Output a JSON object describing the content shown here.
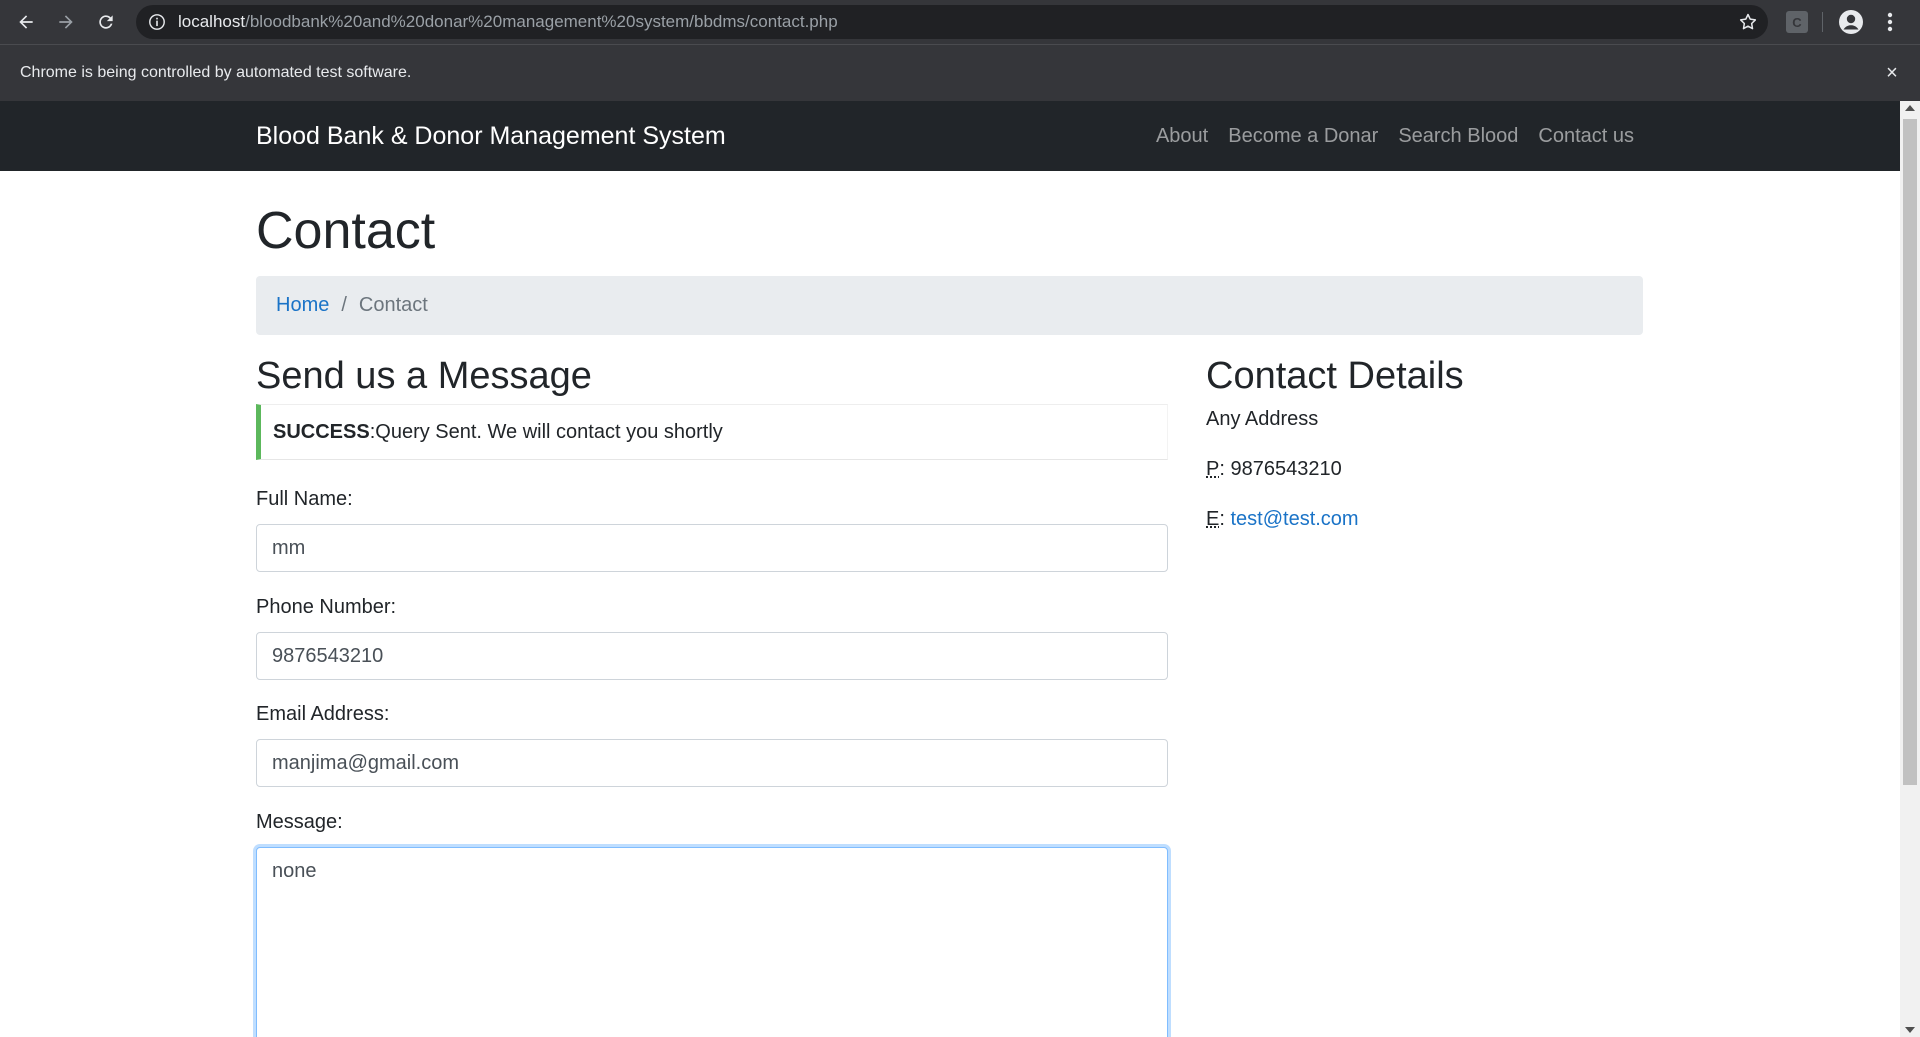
{
  "browser": {
    "url_host": "localhost",
    "url_path": "/bloodbank%20and%20donar%20management%20system/bbdms/contact.php",
    "ext_letter": "C",
    "infobar_message": "Chrome is being controlled by automated test software.",
    "infobar_close": "×"
  },
  "navbar": {
    "brand": "Blood Bank & Donor Management System",
    "links": [
      "About",
      "Become a Donar",
      "Search Blood",
      "Contact us"
    ]
  },
  "page": {
    "title": "Contact",
    "breadcrumb": {
      "home": "Home",
      "separator": "/",
      "current": "Contact"
    }
  },
  "form": {
    "heading": "Send us a Message",
    "alert_strong": "SUCCESS",
    "alert_text": ":Query Sent. We will contact you shortly",
    "full_name_label": "Full Name:",
    "full_name_value": "mm",
    "phone_label": "Phone Number:",
    "phone_value": "9876543210",
    "email_label": "Email Address:",
    "email_value": "manjima@gmail.com",
    "message_label": "Message:",
    "message_value": "none"
  },
  "contact_details": {
    "heading": "Contact Details",
    "address": "Any Address",
    "phone_abbr": "P",
    "phone": "9876543210",
    "email_abbr": "E",
    "email": "test@test.com"
  },
  "colors": {
    "navbar_bg": "#212529",
    "link": "#1a73c7",
    "success_border": "#5cb85c",
    "breadcrumb_bg": "#e9ecef"
  }
}
